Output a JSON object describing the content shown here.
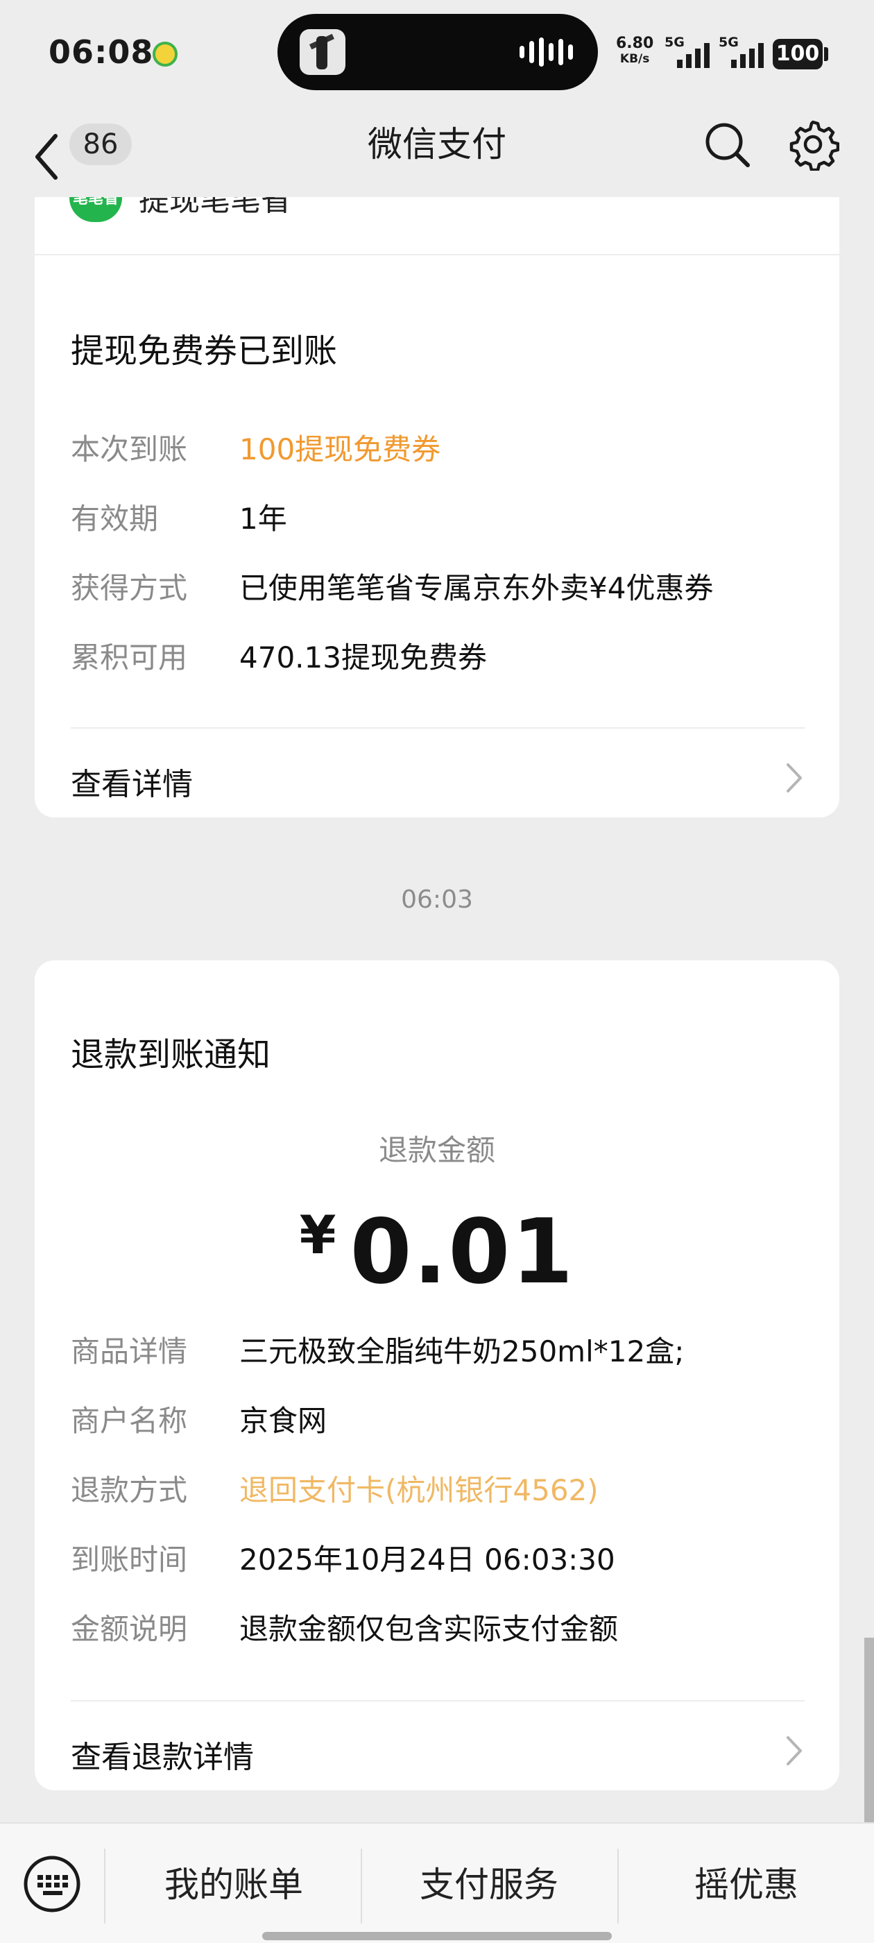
{
  "status_bar": {
    "time": "06:08",
    "net_speed_value": "6.80",
    "net_speed_unit": "KB/s",
    "sim1_label": "5G",
    "sim2_label": "5G",
    "battery": "100",
    "music_icon": "qq-music-icon"
  },
  "nav": {
    "back_icon": "chevron-left-icon",
    "unread_count": "86",
    "title": "微信支付",
    "search_icon": "search-icon",
    "settings_icon": "gear-icon"
  },
  "card1": {
    "service_logo_text": "笔笔省",
    "service_name": "提现笔笔省",
    "title": "提现免费券已到账",
    "rows": [
      {
        "label": "本次到账",
        "value": "100提现免费券"
      },
      {
        "label": "有效期",
        "value": "1年"
      },
      {
        "label": "获得方式",
        "value": "已使用笔笔省专属京东外卖¥4优惠券"
      },
      {
        "label": "累积可用",
        "value": "470.13提现免费券"
      }
    ],
    "link_label": "查看详情"
  },
  "time_separator": "06:03",
  "card2": {
    "title": "退款到账通知",
    "amount_label": "退款金额",
    "currency": "¥",
    "amount": "0.01",
    "rows": [
      {
        "label": "商品详情",
        "value": "三元极致全脂纯牛奶250ml*12盒;"
      },
      {
        "label": "商户名称",
        "value": "京食网"
      },
      {
        "label": "退款方式",
        "value": "退回支付卡(杭州银行4562)"
      },
      {
        "label": "到账时间",
        "value": "2025年10月24日 06:03:30"
      },
      {
        "label": "金额说明",
        "value": "退款金额仅包含实际支付金额"
      }
    ],
    "link_label": "查看退款详情"
  },
  "bottom_menu": {
    "keyboard_icon": "keyboard-icon",
    "items": [
      "我的账单",
      "支付服务",
      "摇优惠"
    ]
  },
  "colors": {
    "highlight_orange": "#f1992f",
    "light_orange": "#f0b864",
    "brand_green": "#24b44e"
  }
}
